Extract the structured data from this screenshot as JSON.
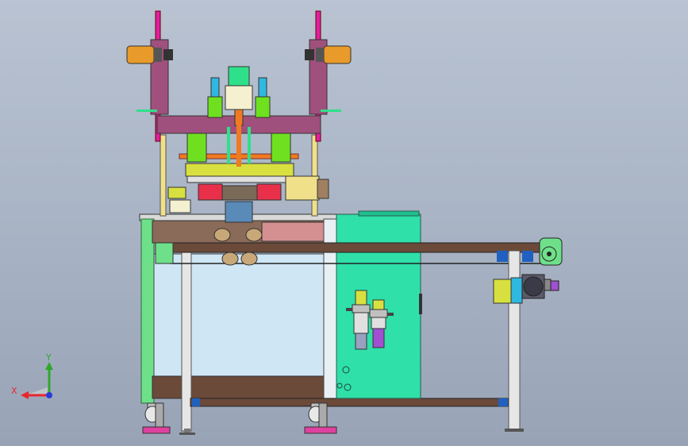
{
  "viewport": {
    "background_top": "#b9c3d2",
    "background_bottom": "#98a4b6"
  },
  "triad": {
    "x_label": "X",
    "y_label": "Y",
    "x_color": "#e8262f",
    "y_color": "#2fa82a",
    "z_color": "#2a3bd6"
  },
  "colors": {
    "frame_green": "#6fe08a",
    "cabinet_green": "#2fe0a8",
    "aluminum": "#c8c8c8",
    "panel_glass": "#cfe6f5",
    "brown_rail": "#6b4a3a",
    "purple_plate": "#a0507c",
    "orange_motor": "#e89a2a",
    "red_block": "#e8304a",
    "yellow_motor": "#f0e08a",
    "magenta_rod": "#e020a0",
    "foot_pink": "#e040a0"
  }
}
